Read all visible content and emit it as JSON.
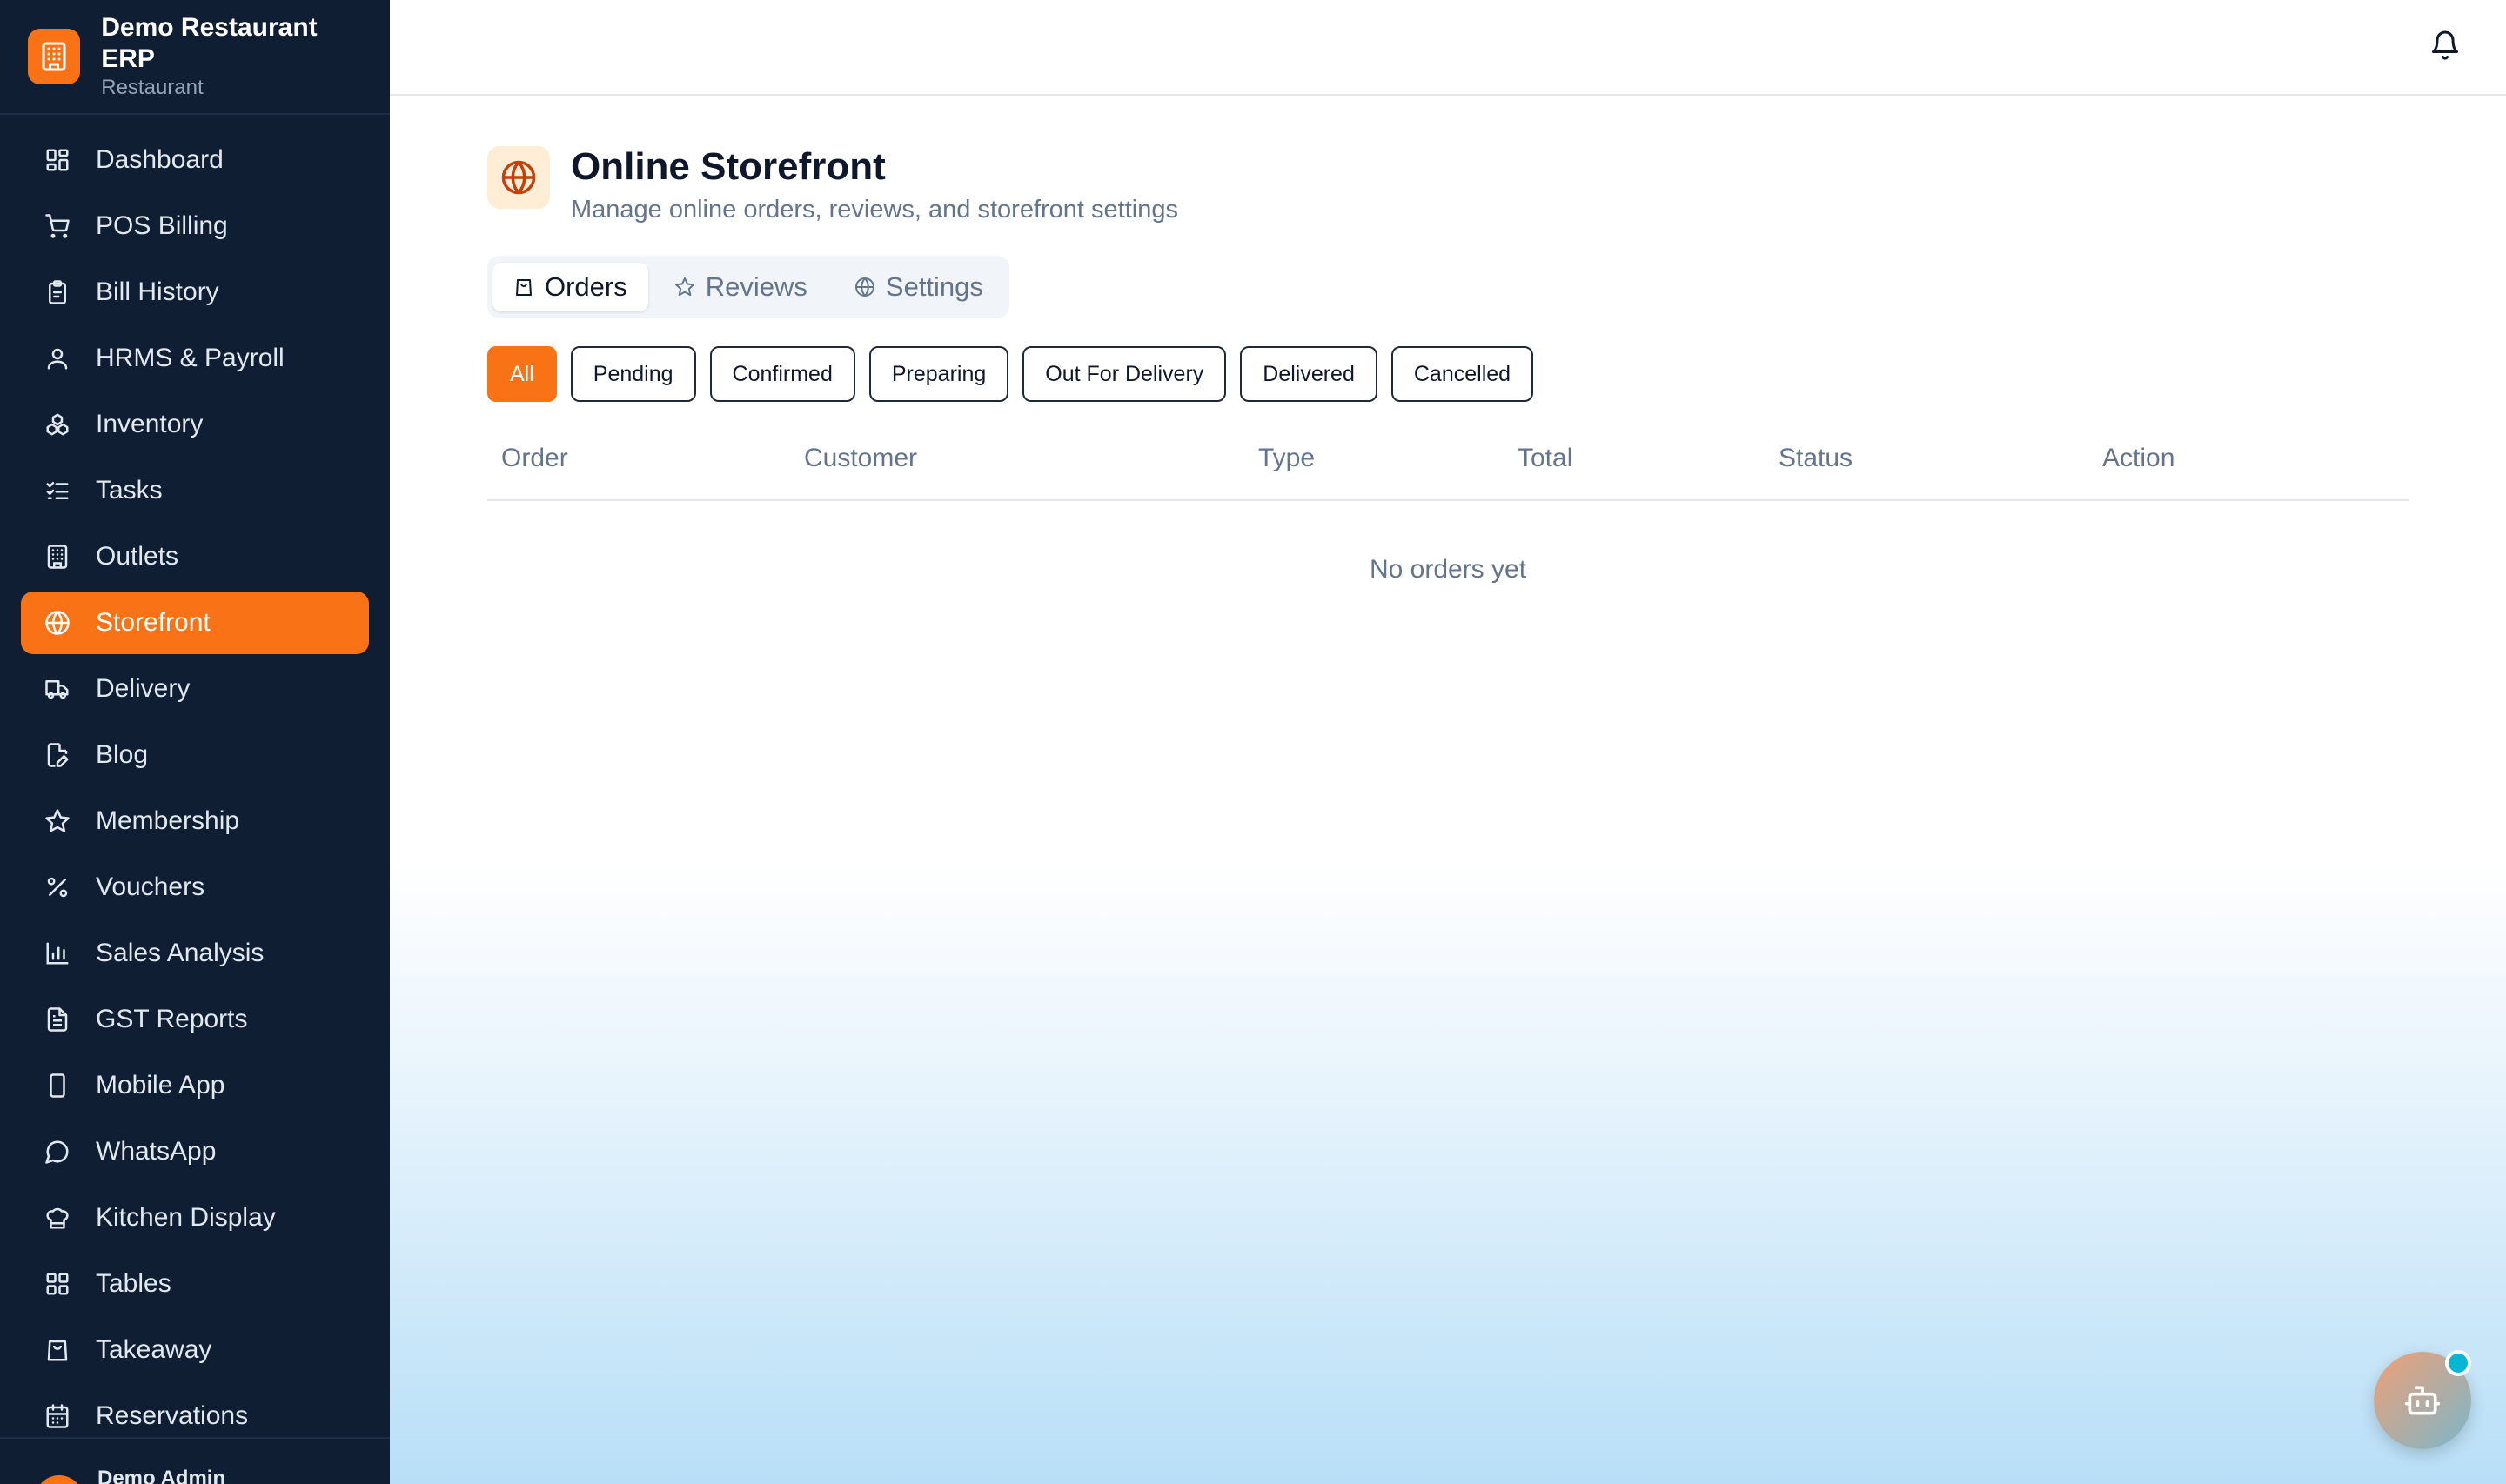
{
  "brand": {
    "title": "Demo Restaurant ERP",
    "subtitle": "Restaurant",
    "logo_icon": "building-icon"
  },
  "sidebar": {
    "items": [
      {
        "label": "Dashboard",
        "icon": "grid-icon"
      },
      {
        "label": "POS Billing",
        "icon": "cart-icon"
      },
      {
        "label": "Bill History",
        "icon": "clipboard-icon"
      },
      {
        "label": "HRMS & Payroll",
        "icon": "user-icon"
      },
      {
        "label": "Inventory",
        "icon": "boxes-icon"
      },
      {
        "label": "Tasks",
        "icon": "list-check-icon"
      },
      {
        "label": "Outlets",
        "icon": "building-icon"
      },
      {
        "label": "Storefront",
        "icon": "globe-icon",
        "active": true
      },
      {
        "label": "Delivery",
        "icon": "truck-icon"
      },
      {
        "label": "Blog",
        "icon": "file-pen-icon"
      },
      {
        "label": "Membership",
        "icon": "star-icon"
      },
      {
        "label": "Vouchers",
        "icon": "percent-icon"
      },
      {
        "label": "Sales Analysis",
        "icon": "bar-chart-icon"
      },
      {
        "label": "GST Reports",
        "icon": "file-text-icon"
      },
      {
        "label": "Mobile App",
        "icon": "smartphone-icon"
      },
      {
        "label": "WhatsApp",
        "icon": "message-circle-icon"
      },
      {
        "label": "Kitchen Display",
        "icon": "chef-hat-icon"
      },
      {
        "label": "Tables",
        "icon": "grid-icon"
      },
      {
        "label": "Takeaway",
        "icon": "shopping-bag-icon"
      },
      {
        "label": "Reservations",
        "icon": "calendar-icon"
      }
    ]
  },
  "user": {
    "name": "Demo Admin"
  },
  "page": {
    "title": "Online Storefront",
    "subtitle": "Manage online orders, reviews, and storefront settings",
    "icon": "globe-icon"
  },
  "tabs": [
    {
      "label": "Orders",
      "icon": "shopping-bag-icon",
      "active": true
    },
    {
      "label": "Reviews",
      "icon": "star-icon"
    },
    {
      "label": "Settings",
      "icon": "globe-icon"
    }
  ],
  "filters": [
    {
      "label": "All",
      "active": true
    },
    {
      "label": "Pending"
    },
    {
      "label": "Confirmed"
    },
    {
      "label": "Preparing"
    },
    {
      "label": "Out For Delivery"
    },
    {
      "label": "Delivered"
    },
    {
      "label": "Cancelled"
    }
  ],
  "table": {
    "columns": [
      "Order",
      "Customer",
      "Type",
      "Total",
      "Status",
      "Action"
    ],
    "empty_text": "No orders yet"
  },
  "colors": {
    "accent": "#f97316",
    "sidebar": "#0f1e33",
    "fab_dot": "#06b6d4"
  }
}
